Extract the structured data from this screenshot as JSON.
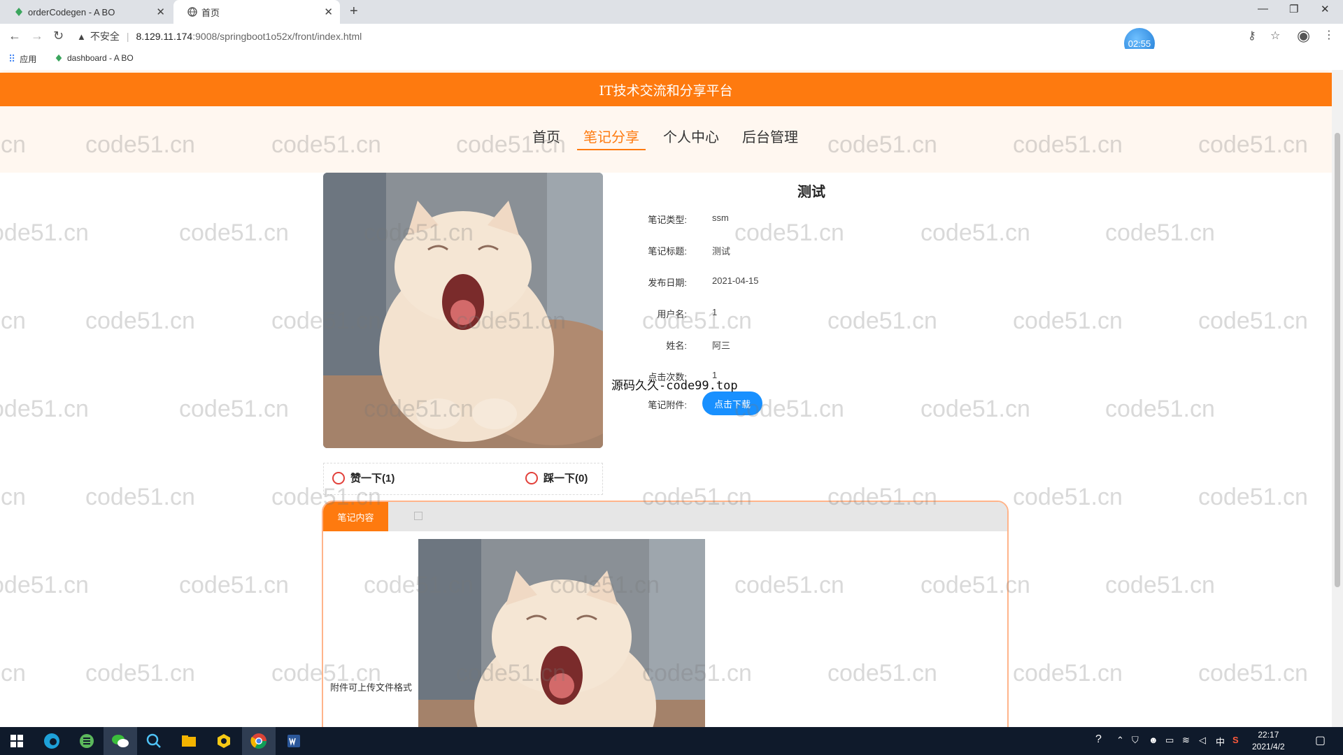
{
  "browser": {
    "tabs": [
      {
        "title": "orderCodegen - A BO"
      },
      {
        "title": "首页"
      }
    ],
    "security_label": "不安全",
    "url_host": "8.129.11.174",
    "url_rest": ":9008/springboot1o52x/front/index.html",
    "timer": "02:55",
    "bookmarks": [
      {
        "label": "应用"
      },
      {
        "label": "dashboard - A BO"
      }
    ]
  },
  "site": {
    "brand": "IT技术交流和分享平台",
    "menu": [
      {
        "label": "首页"
      },
      {
        "label": "笔记分享"
      },
      {
        "label": "个人中心"
      },
      {
        "label": "后台管理"
      }
    ],
    "active_menu": "笔记分享"
  },
  "detail": {
    "title": "测试",
    "fields": [
      {
        "label": "笔记类型:",
        "value": "ssm"
      },
      {
        "label": "笔记标题:",
        "value": "测试"
      },
      {
        "label": "发布日期:",
        "value": "2021-04-15"
      },
      {
        "label": "用户名:",
        "value": "1"
      },
      {
        "label": "姓名:",
        "value": "阿三"
      },
      {
        "label": "点击次数:",
        "value": "1"
      },
      {
        "label": "笔记附件:",
        "value": ""
      }
    ],
    "download_label": "点击下载",
    "overlay_text": "源码久久-code99.top",
    "like_label": "赞一下(1)",
    "dislike_label": "踩一下(0)"
  },
  "content": {
    "tab_label": "笔记内容",
    "side_text": "附件可上传文件格式"
  },
  "watermark": "code51.cn",
  "taskbar": {
    "time": "22:17",
    "date": "2021/4/2",
    "ime": "中"
  },
  "colors": {
    "brand_orange": "#fe7a0f",
    "nav_bg": "#fff7f0",
    "download_blue": "#1890ff",
    "vote_red": "#e2403a"
  }
}
